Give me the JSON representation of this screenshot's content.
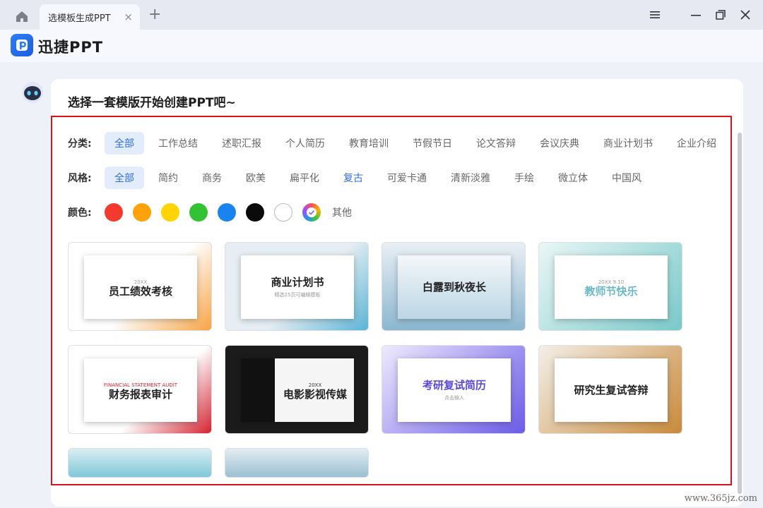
{
  "window": {
    "tab_title": "选模板生成PPT",
    "tab_close": "×",
    "tab_add": "+"
  },
  "app": {
    "name": "迅捷PPT"
  },
  "assistant": {
    "prompt": "选择一套模版开始创建PPT吧~"
  },
  "filters": {
    "category_label": "分类:",
    "categories": [
      "全部",
      "工作总结",
      "述职汇报",
      "个人简历",
      "教育培训",
      "节假节日",
      "论文答辩",
      "会议庆典",
      "商业计划书",
      "企业介绍"
    ],
    "style_label": "风格:",
    "styles": [
      "全部",
      "简约",
      "商务",
      "欧美",
      "扁平化",
      "复古",
      "可爱卡通",
      "清新淡雅",
      "手绘",
      "微立体",
      "中国风"
    ],
    "color_label": "颜色:",
    "colors": [
      "#f23a2e",
      "#ffa10a",
      "#ffd400",
      "#33c233",
      "#1a84ee",
      "#0b0b0b",
      "#ffffff",
      "gradient"
    ],
    "color_other": "其他"
  },
  "templates": [
    {
      "title": "员工绩效考核",
      "sub": "20XX",
      "accent": "#f7a444"
    },
    {
      "title": "商业计划书",
      "sub": "精选25页可编辑模板",
      "accent": "#5ab4d6"
    },
    {
      "title": "白露到秋夜长",
      "sub": "",
      "accent": "#8bb7cf"
    },
    {
      "title": "教师节快乐",
      "sub": "20XX 9.10",
      "accent": "#79c9c9"
    },
    {
      "title": "财务报表审计",
      "sub": "FINANCIAL STATEMENT AUDIT",
      "accent": "#d42330"
    },
    {
      "title": "电影影视传媒",
      "sub": "20XX",
      "accent": "#111111"
    },
    {
      "title": "考研复试简历",
      "sub": "点击输入",
      "accent": "#6b5be8"
    },
    {
      "title": "研究生复试答辩",
      "sub": "",
      "accent": "#c98a3b"
    },
    {
      "title": "",
      "sub": "",
      "accent": "#7fc8d8"
    },
    {
      "title": "",
      "sub": "",
      "accent": "#9bbfd2"
    }
  ],
  "watermark": "www.365jz.com"
}
